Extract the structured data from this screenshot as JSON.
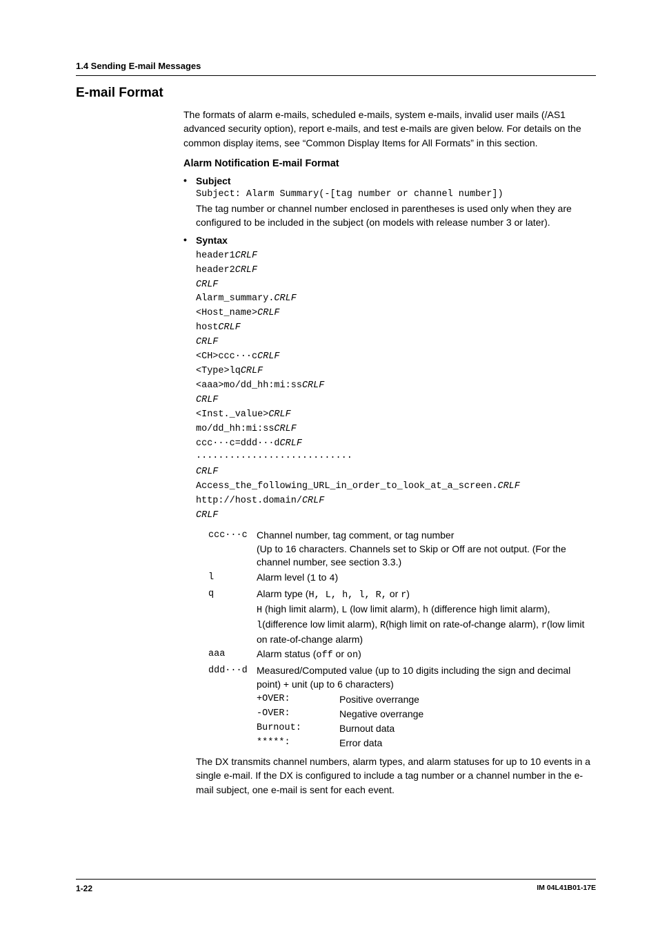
{
  "breadcrumb": "1.4  Sending E-mail Messages",
  "sectionTitle": "E-mail Format",
  "intro": "The formats of alarm e-mails, scheduled e-mails, system e-mails, invalid user mails (/AS1 advanced security option), report e-mails, and test e-mails are given below.  For details on the common display items, see “Common Display Items for All Formats” in this section.",
  "alarmHead": "Alarm Notification E-mail Format",
  "subjectLabel": "Subject",
  "subjectCodePrefix": "Subject:",
  "subjectCodeBody": "Alarm Summary(-[tag number or channel number])",
  "subjectNote": "The tag number or channel number enclosed in parentheses is used only when they are configured to be included in the subject (on models with release number 3 or later).",
  "syntaxLabel": "Syntax",
  "syntaxLines": [
    {
      "pre": "header1",
      "crlf": true
    },
    {
      "pre": "header2",
      "crlf": true
    },
    {
      "pre": "",
      "crlf": true
    },
    {
      "pre": "Alarm_summary.",
      "crlf": true
    },
    {
      "pre": "<Host_name>",
      "crlf": true
    },
    {
      "pre": "host",
      "crlf": true
    },
    {
      "pre": "",
      "crlf": true
    },
    {
      "pre": "<CH>ccc···c",
      "crlf": true
    },
    {
      "pre": "<Type>lq",
      "crlf": true
    },
    {
      "pre": "<aaa>mo/dd_hh:mi:ss",
      "crlf": true
    },
    {
      "pre": "",
      "crlf": true
    },
    {
      "pre": "<Inst._value>",
      "crlf": true
    },
    {
      "pre": "mo/dd_hh:mi:ss",
      "crlf": true
    },
    {
      "pre": "ccc···c=ddd···d",
      "crlf": true
    },
    {
      "pre": "····························",
      "crlf": false
    },
    {
      "pre": "",
      "crlf": true
    },
    {
      "pre": "Access_the_following_URL_in_order_to_look_at_a_screen.",
      "crlf": true
    },
    {
      "pre": "http://host.domain/",
      "crlf": true
    },
    {
      "pre": "",
      "crlf": true
    }
  ],
  "defs": {
    "ccc": {
      "term": "ccc···c",
      "l1": "Channel number, tag comment, or tag number",
      "l2": "(Up to 16 characters.  Channels set to Skip or Off are not output.  (For the channel number, see section 3.3.)"
    },
    "l": {
      "term": "l",
      "pre": "Alarm level (",
      "mono": "1",
      "mid": " to ",
      "mono2": "4",
      "post": ")"
    },
    "q": {
      "term": "q",
      "pre": "Alarm type (",
      "types": "H, L, h, l, R,",
      "or": " or ",
      "last": "r",
      "post": ")",
      "detailParts": [
        {
          "m": "H",
          "t": " (high limit alarm), "
        },
        {
          "m": "L",
          "t": " (low limit alarm), "
        },
        {
          "m": "h",
          "t": " (difference high limit alarm), "
        },
        {
          "m": "l",
          "t": "(difference low limit alarm), "
        },
        {
          "m": "R",
          "t": "(high limit on rate-of-change alarm), "
        },
        {
          "m": "r",
          "t": "(low limit on rate-of-change alarm)"
        }
      ]
    },
    "aaa": {
      "term": "aaa",
      "pre": "Alarm status (",
      "mono": "off",
      "mid": " or ",
      "mono2": "on",
      "post": ")"
    },
    "ddd": {
      "term": "ddd···d",
      "l1": "Measured/Computed value (up to 10 digits including the sign and decimal point) + unit (up to 6 characters)",
      "vals": [
        {
          "k": "+OVER:",
          "v": "Positive overrange"
        },
        {
          "k": "-OVER:",
          "v": "Negative overrange"
        },
        {
          "k": "Burnout:",
          "v": "Burnout data"
        },
        {
          "k": "*****:",
          "v": "Error data"
        }
      ]
    }
  },
  "closing": "The DX transmits channel numbers, alarm types, and alarm statuses for up to 10 events in a single e-mail. If the DX is configured to include a tag number or a channel number in the e-mail subject, one e-mail is sent for each event.",
  "footer": {
    "left": "1-22",
    "right": "IM 04L41B01-17E"
  }
}
